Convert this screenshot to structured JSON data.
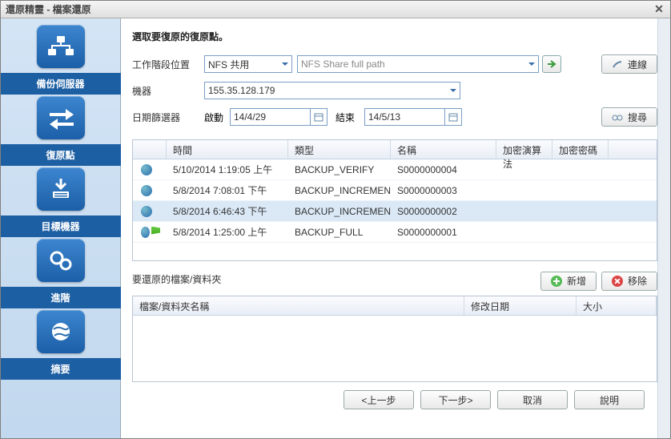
{
  "title": "還原精靈 - 檔案還原",
  "sidebar": {
    "items": [
      {
        "label": "備份伺服器"
      },
      {
        "label": "復原點"
      },
      {
        "label": "目標機器"
      },
      {
        "label": "進階"
      },
      {
        "label": "摘要"
      }
    ]
  },
  "heading": "選取要復原的復原點。",
  "labels": {
    "stage_location": "工作階段位置",
    "machine": "機器",
    "date_filter": "日期篩選器",
    "start": "啟動",
    "end": "結束"
  },
  "stage_location": {
    "type": "NFS 共用",
    "path_placeholder": "NFS Share full path"
  },
  "machine": "155.35.128.179",
  "dates": {
    "start": "14/4/29",
    "end": "14/5/13"
  },
  "buttons": {
    "connect": "連線",
    "search": "搜尋",
    "add": "新增",
    "remove": "移除",
    "prev": "<上一步",
    "next": "下一步>",
    "cancel": "取消",
    "help": "說明"
  },
  "grid": {
    "headers": {
      "time": "時間",
      "type": "類型",
      "name": "名稱",
      "alg": "加密演算法",
      "pwd": "加密密碼"
    },
    "rows": [
      {
        "time": "5/10/2014 1:19:05 上午",
        "type": "BACKUP_VERIFY",
        "name": "S0000000004",
        "selected": false,
        "flag": false
      },
      {
        "time": "5/8/2014 7:08:01 下午",
        "type": "BACKUP_INCREMENTAL",
        "name": "S0000000003",
        "selected": false,
        "flag": false
      },
      {
        "time": "5/8/2014 6:46:43 下午",
        "type": "BACKUP_INCREMENTAL",
        "name": "S0000000002",
        "selected": true,
        "flag": false
      },
      {
        "time": "5/8/2014 1:25:00 上午",
        "type": "BACKUP_FULL",
        "name": "S0000000001",
        "selected": false,
        "flag": true
      }
    ]
  },
  "files_section": "要還原的檔案/資料夾",
  "grid2": {
    "headers": {
      "name": "檔案/資料夾名稱",
      "date": "修改日期",
      "size": "大小"
    }
  }
}
